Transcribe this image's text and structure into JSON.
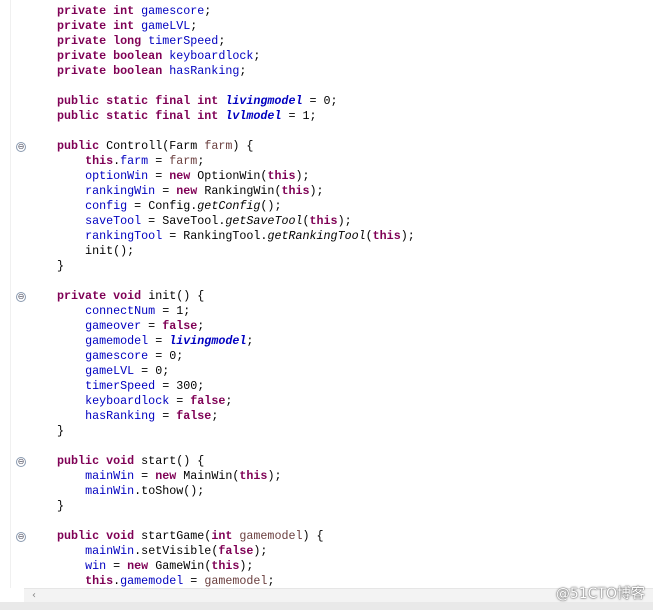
{
  "editor": {
    "lines": [
      [
        [
          "k",
          "private int "
        ],
        [
          "f",
          "gamescore"
        ],
        [
          "",
          "; "
        ]
      ],
      [
        [
          "k",
          "private int "
        ],
        [
          "f",
          "gameLVL"
        ],
        [
          "",
          ";"
        ]
      ],
      [
        [
          "k",
          "private long "
        ],
        [
          "f",
          "timerSpeed"
        ],
        [
          "",
          ";"
        ]
      ],
      [
        [
          "k",
          "private boolean "
        ],
        [
          "f",
          "keyboardlock"
        ],
        [
          "",
          ";"
        ]
      ],
      [
        [
          "k",
          "private boolean "
        ],
        [
          "f",
          "hasRanking"
        ],
        [
          "",
          ";"
        ]
      ],
      [],
      [
        [
          "k",
          "public static final int "
        ],
        [
          "s",
          "livingmodel"
        ],
        [
          "",
          " = 0;"
        ]
      ],
      [
        [
          "k",
          "public static final int "
        ],
        [
          "s",
          "lvlmodel"
        ],
        [
          "",
          " = 1;"
        ]
      ],
      [],
      [
        [
          "k",
          "public "
        ],
        [
          "",
          "Controll(Farm "
        ],
        [
          "p",
          "farm"
        ],
        [
          "",
          ") {"
        ]
      ],
      [
        [
          "",
          "    "
        ],
        [
          "k",
          "this"
        ],
        [
          "",
          "."
        ],
        [
          "f",
          "farm"
        ],
        [
          "",
          " = "
        ],
        [
          "p",
          "farm"
        ],
        [
          "",
          ";"
        ]
      ],
      [
        [
          "",
          "    "
        ],
        [
          "f",
          "optionWin"
        ],
        [
          "",
          " = "
        ],
        [
          "k",
          "new "
        ],
        [
          "",
          "OptionWin("
        ],
        [
          "k",
          "this"
        ],
        [
          "",
          ");"
        ]
      ],
      [
        [
          "",
          "    "
        ],
        [
          "f",
          "rankingWin"
        ],
        [
          "",
          " = "
        ],
        [
          "k",
          "new "
        ],
        [
          "",
          "RankingWin("
        ],
        [
          "k",
          "this"
        ],
        [
          "",
          ");"
        ]
      ],
      [
        [
          "",
          "    "
        ],
        [
          "f",
          "config"
        ],
        [
          "",
          " = Config."
        ],
        [
          "m",
          "getConfig"
        ],
        [
          "",
          "();"
        ]
      ],
      [
        [
          "",
          "    "
        ],
        [
          "f",
          "saveTool"
        ],
        [
          "",
          " = SaveTool."
        ],
        [
          "m",
          "getSaveTool"
        ],
        [
          "",
          "("
        ],
        [
          "k",
          "this"
        ],
        [
          "",
          ");"
        ]
      ],
      [
        [
          "",
          "    "
        ],
        [
          "f",
          "rankingTool"
        ],
        [
          "",
          " = RankingTool."
        ],
        [
          "m",
          "getRankingTool"
        ],
        [
          "",
          "("
        ],
        [
          "k",
          "this"
        ],
        [
          "",
          ");"
        ]
      ],
      [
        [
          "",
          "    init();"
        ]
      ],
      [
        [
          "",
          "}"
        ]
      ],
      [],
      [
        [
          "k",
          "private void "
        ],
        [
          "",
          "init() {"
        ]
      ],
      [
        [
          "",
          "    "
        ],
        [
          "f",
          "connectNum"
        ],
        [
          "",
          " = 1;"
        ]
      ],
      [
        [
          "",
          "    "
        ],
        [
          "f",
          "gameover"
        ],
        [
          "",
          " = "
        ],
        [
          "k",
          "false"
        ],
        [
          "",
          ";"
        ]
      ],
      [
        [
          "",
          "    "
        ],
        [
          "f",
          "gamemodel"
        ],
        [
          "",
          " = "
        ],
        [
          "s",
          "livingmodel"
        ],
        [
          "",
          ";"
        ]
      ],
      [
        [
          "",
          "    "
        ],
        [
          "f",
          "gamescore"
        ],
        [
          "",
          " = 0;"
        ]
      ],
      [
        [
          "",
          "    "
        ],
        [
          "f",
          "gameLVL"
        ],
        [
          "",
          " = 0;"
        ]
      ],
      [
        [
          "",
          "    "
        ],
        [
          "f",
          "timerSpeed"
        ],
        [
          "",
          " = 300;"
        ]
      ],
      [
        [
          "",
          "    "
        ],
        [
          "f",
          "keyboardlock"
        ],
        [
          "",
          " = "
        ],
        [
          "k",
          "false"
        ],
        [
          "",
          ";"
        ]
      ],
      [
        [
          "",
          "    "
        ],
        [
          "f",
          "hasRanking"
        ],
        [
          "",
          " = "
        ],
        [
          "k",
          "false"
        ],
        [
          "",
          ";"
        ]
      ],
      [
        [
          "",
          "}"
        ]
      ],
      [],
      [
        [
          "k",
          "public void "
        ],
        [
          "",
          "start() {"
        ]
      ],
      [
        [
          "",
          "    "
        ],
        [
          "f",
          "mainWin"
        ],
        [
          "",
          " = "
        ],
        [
          "k",
          "new "
        ],
        [
          "",
          "MainWin("
        ],
        [
          "k",
          "this"
        ],
        [
          "",
          ");"
        ]
      ],
      [
        [
          "",
          "    "
        ],
        [
          "f",
          "mainWin"
        ],
        [
          "",
          ".toShow();"
        ]
      ],
      [
        [
          "",
          "}"
        ]
      ],
      [],
      [
        [
          "k",
          "public void "
        ],
        [
          "",
          "startGame("
        ],
        [
          "k",
          "int "
        ],
        [
          "p",
          "gamemodel"
        ],
        [
          "",
          ") {"
        ]
      ],
      [
        [
          "",
          "    "
        ],
        [
          "f",
          "mainWin"
        ],
        [
          "",
          ".setVisible("
        ],
        [
          "k",
          "false"
        ],
        [
          "",
          ");"
        ]
      ],
      [
        [
          "",
          "    "
        ],
        [
          "f",
          "win"
        ],
        [
          "",
          " = "
        ],
        [
          "k",
          "new "
        ],
        [
          "",
          "GameWin("
        ],
        [
          "k",
          "this"
        ],
        [
          "",
          ");"
        ]
      ],
      [
        [
          "",
          "    "
        ],
        [
          "k",
          "this"
        ],
        [
          "",
          "."
        ],
        [
          "f",
          "gamemodel"
        ],
        [
          "",
          " = "
        ],
        [
          "p",
          "gamemodel"
        ],
        [
          "",
          ";"
        ]
      ]
    ],
    "fold_lines": [
      9,
      19,
      30,
      35
    ],
    "fold_glyph": "⊖"
  },
  "scrollbar": {
    "left_arrow": "‹"
  },
  "watermark": "@51CTO博客",
  "colors": {
    "keyword": "#7f0055",
    "field": "#0000c0",
    "param": "#6a3e3e"
  }
}
